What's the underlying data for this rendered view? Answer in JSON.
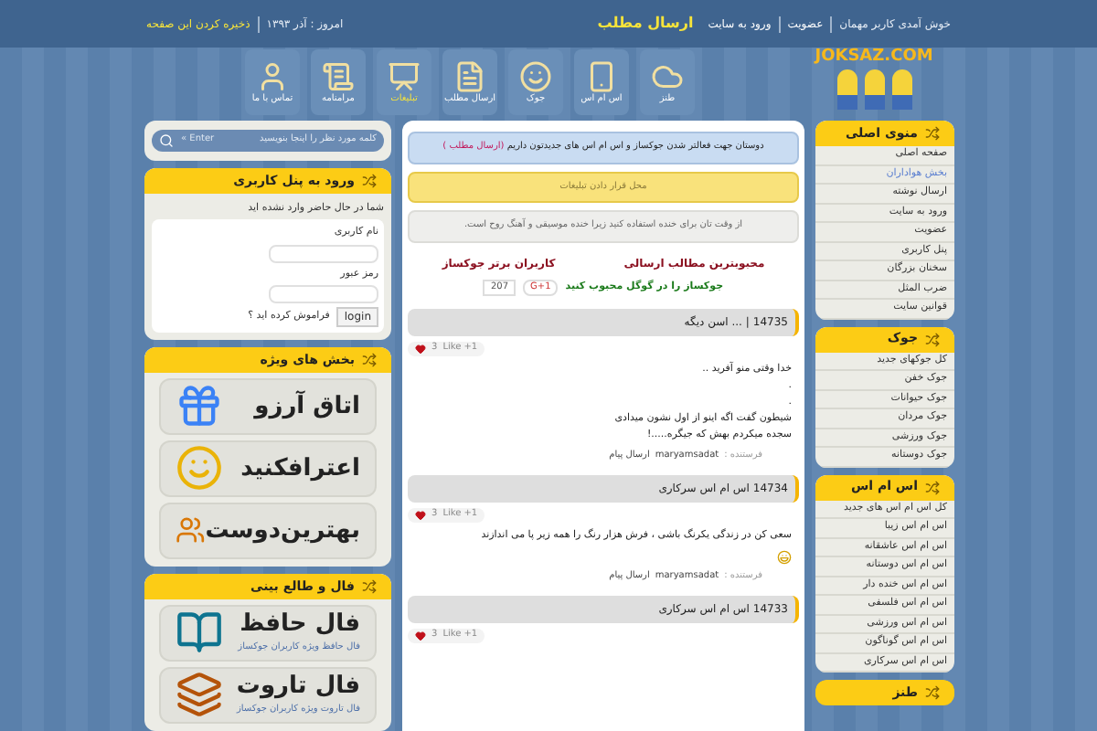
{
  "top_bar": {
    "welcome": "خوش آمدی کاربر مهمان",
    "links": [
      "عضویت",
      "ورود به سایت"
    ],
    "send_link": "ارسال مطلب",
    "date": "امروز : آذر ۱۳۹۳",
    "bookmark": "ذخیره کردن این صفحه"
  },
  "logo": "JOKSAZ.COM",
  "nav": [
    {
      "label": "طنز",
      "selected": false
    },
    {
      "label": "اس ام اس",
      "selected": false
    },
    {
      "label": "جوک",
      "selected": false
    },
    {
      "label": "ارسال مطلب",
      "selected": false
    },
    {
      "label": "تبلیغات",
      "selected": true
    },
    {
      "label": "مرامنامه",
      "selected": false
    },
    {
      "label": "تماس با ما",
      "selected": false
    }
  ],
  "search": {
    "placeholder": "کلمه مورد نظر را اینجا بنویسید",
    "button": "Enter »"
  },
  "login": {
    "title": "ورود به پنل کاربری",
    "status": "شما در حال حاضر وارد نشده اید",
    "username_label": "نام کاربری",
    "password_label": "رمز عبور",
    "button": "login",
    "forgot": "فراموش کرده اید ؟"
  },
  "special": {
    "title": "بخش های ویژه",
    "banners": [
      {
        "title": "اتاق آرزو"
      },
      {
        "title": "اعترافکنید"
      },
      {
        "title": "بهترین‌دوست"
      }
    ]
  },
  "fortune": {
    "title": "فال و طالع بینی",
    "banners": [
      {
        "title": "فال حافظ",
        "subtitle": "فال حافظ ویژه کاربران جوکساز"
      },
      {
        "title": "فال تاروت",
        "subtitle": "فال تاروت ویژه کاربران جوکساز"
      }
    ]
  },
  "notice": {
    "text": "دوستان جهت فعالتر شدن جوکساز و اس ام اس های جدیدتون داریم",
    "link": "(ارسال مطلب )"
  },
  "ad": "محل قرار دادن تبلیغات",
  "quote": "از وقت تان برای خنده استفاده کنید زیرا خنده موسیقی و آهنگ روح است.",
  "top_links": [
    "محبوبترین مطالب ارسالی",
    "کاربران برتر جوکساز"
  ],
  "google": {
    "text": "جوکساز را در گوگل محبوب کنید",
    "button": "G+1",
    "count": "207"
  },
  "posts": [
    {
      "number": "14735",
      "title": "| ... اسن دیگه",
      "likes": "3",
      "like": "Like +1",
      "lines": [
        "خدا وقتی منو آفرید ..",
        ".",
        ".",
        "شیطون گفت اگه اینو از اول نشون میدادی",
        "سجده میکردم بهش که جیگره.....!"
      ],
      "sender_label": "فرستنده :",
      "sender": "maryamsadat",
      "message": "ارسال پیام"
    },
    {
      "number": "14734",
      "title": "اس ام اس سرکاری",
      "likes": "3",
      "like": "Like +1",
      "lines": [
        "سعی کن در زندگی یکرنگ باشی ، فرش هزار رنگ را همه زیر پا می اندازند"
      ],
      "emoji": true,
      "sender_label": "فرستنده :",
      "sender": "maryamsadat",
      "message": "ارسال پیام"
    },
    {
      "number": "14733",
      "title": "اس ام اس سرکاری",
      "likes": "3",
      "like": "Like +1"
    }
  ],
  "menus": [
    {
      "title": "منوی اصلی",
      "items": [
        {
          "label": "صفحه اصلی",
          "highlighted": false
        },
        {
          "label": "بخش هواداران",
          "highlighted": true
        },
        {
          "label": "ارسال نوشته",
          "highlighted": false
        },
        {
          "label": "ورود به سایت",
          "highlighted": false
        },
        {
          "label": "عضویت",
          "highlighted": false
        },
        {
          "label": "پنل کاربری",
          "highlighted": false
        },
        {
          "label": "سخنان بزرگان",
          "highlighted": false
        },
        {
          "label": "ضرب المثل",
          "highlighted": false
        },
        {
          "label": "قوانین سایت",
          "highlighted": false
        }
      ]
    },
    {
      "title": "جوک",
      "items": [
        {
          "label": "کل جوکهای جدید",
          "highlighted": false
        },
        {
          "label": "جوک خفن",
          "highlighted": false
        },
        {
          "label": "جوک حیوانات",
          "highlighted": false
        },
        {
          "label": "جوک مردان",
          "highlighted": false
        },
        {
          "label": "جوک ورزشی",
          "highlighted": false
        },
        {
          "label": "جوک دوستانه",
          "highlighted": false
        }
      ]
    },
    {
      "title": "اس ام اس",
      "items": [
        {
          "label": "کل اس ام اس های جدید",
          "highlighted": false
        },
        {
          "label": "اس ام اس زیبا",
          "highlighted": false
        },
        {
          "label": "اس ام اس عاشقانه",
          "highlighted": false
        },
        {
          "label": "اس ام اس دوستانه",
          "highlighted": false
        },
        {
          "label": "اس ام اس خنده دار",
          "highlighted": false
        },
        {
          "label": "اس ام اس فلسفی",
          "highlighted": false
        },
        {
          "label": "اس ام اس ورزشی",
          "highlighted": false
        },
        {
          "label": "اس ام اس گوناگون",
          "highlighted": false
        },
        {
          "label": "اس ام اس سرکاری",
          "highlighted": false
        }
      ]
    },
    {
      "title": "طنز"
    }
  ]
}
